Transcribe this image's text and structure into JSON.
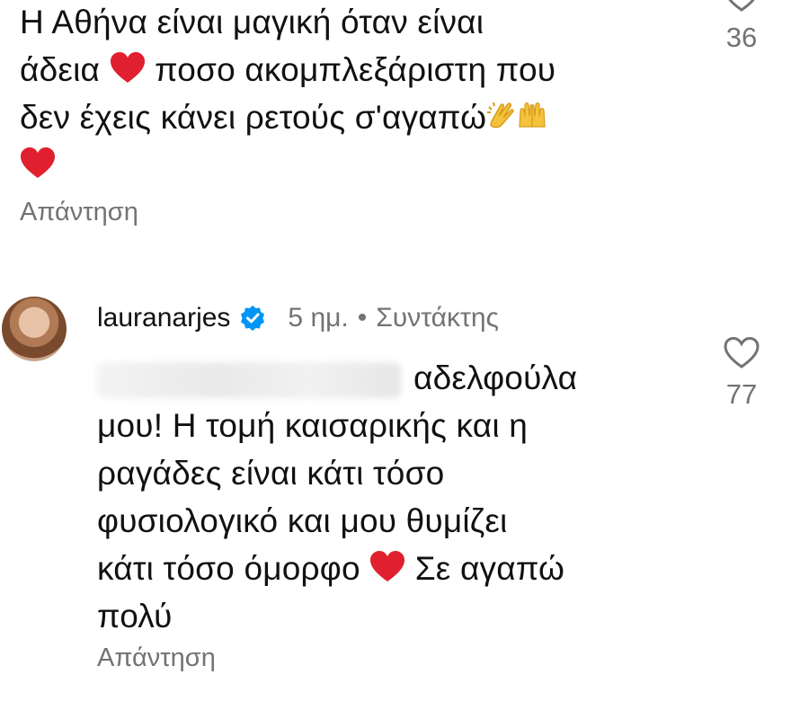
{
  "first_comment": {
    "lines": [
      "Η Αθήνα είναι μαγική όταν είναι",
      [
        "άδεια",
        "ποσο ακομπλεξάριστη που"
      ],
      "δεν έχεις κάνει ρετούς σ'αγαπώ"
    ],
    "like_count": "36",
    "reply_label": "Απάντηση"
  },
  "second_comment": {
    "username": "lauranarjes",
    "time": "5 ημ.",
    "separator": "•",
    "role": "Συντάκτης",
    "lines": [
      "αδελφούλα",
      "μου! Η τομή καισαρικής και η",
      "ραγάδες είναι κάτι τόσο",
      "φυσιολογικό και μου θυμίζει",
      [
        "κάτι τόσο όμορφο",
        "Σε αγαπώ"
      ],
      "πολύ"
    ],
    "like_count": "77",
    "reply_label": "Απάντηση"
  },
  "colors": {
    "heart_red": "#e0202e",
    "verified_blue": "#0095f6",
    "muted_text": "#737373"
  },
  "icons": [
    "heart-emoji",
    "clapping-hands-emoji",
    "raising-hands-emoji",
    "heart-outline-icon",
    "verified-badge-icon"
  ]
}
